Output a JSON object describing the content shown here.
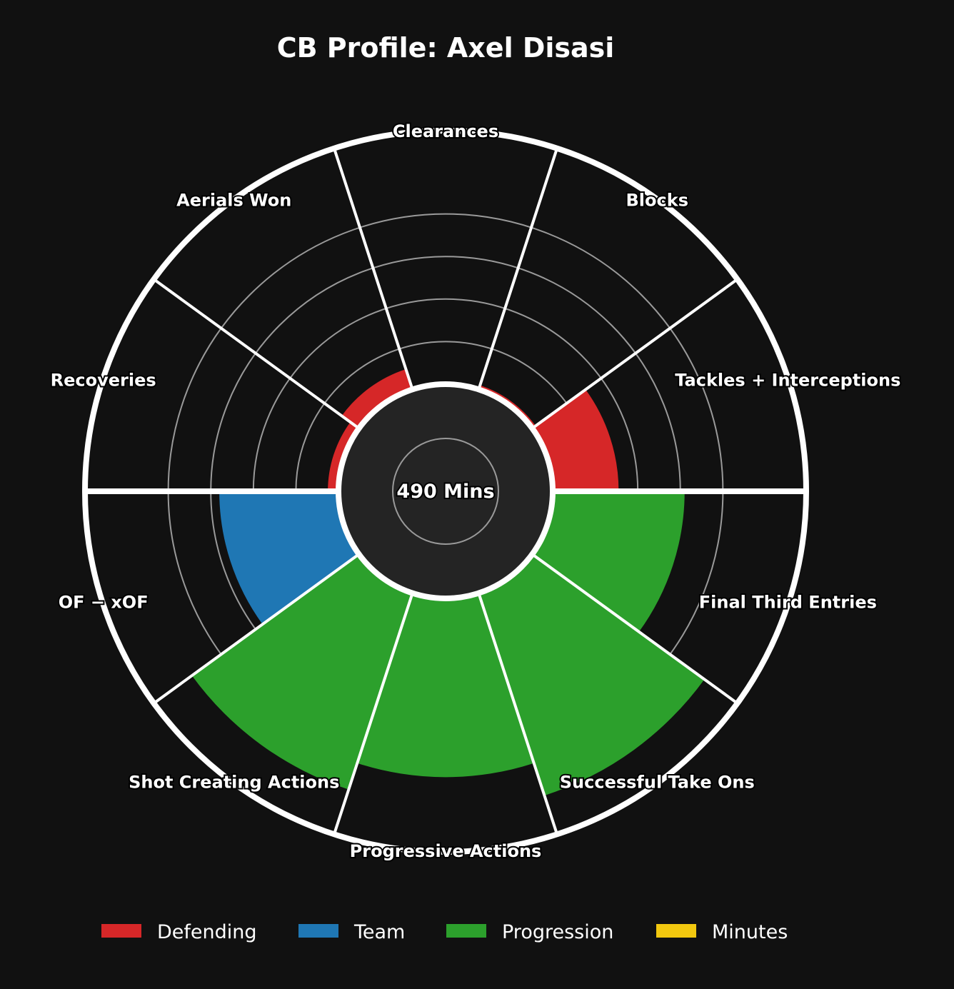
{
  "chart_data": {
    "type": "polar-bar",
    "title": "CB Profile: Axel Disasi",
    "center_label": "490 Mins",
    "scale_max": 100,
    "grid_rings": [
      20,
      40,
      60,
      80
    ],
    "categories": [
      {
        "label": "Tackles + Interceptions",
        "value": 31,
        "group": "Defending"
      },
      {
        "label": "Blocks",
        "value": 2,
        "group": "Defending"
      },
      {
        "label": "Clearances",
        "value": 1,
        "group": "Defending"
      },
      {
        "label": "Aerials Won",
        "value": 10,
        "group": "Defending"
      },
      {
        "label": "Recoveries",
        "value": 5,
        "group": "Defending"
      },
      {
        "label": "OF − xOF",
        "value": 56,
        "group": "Team"
      },
      {
        "label": "Shot Creating Actions",
        "value": 97,
        "group": "Progression"
      },
      {
        "label": "Progressive Actions",
        "value": 84,
        "group": "Progression"
      },
      {
        "label": "Successful Take Ons",
        "value": 100,
        "group": "Progression"
      },
      {
        "label": "Final Third Entries",
        "value": 62,
        "group": "Progression"
      }
    ],
    "legend": {
      "position": "bottom",
      "entries": [
        {
          "name": "Defending",
          "color": "#d62728"
        },
        {
          "name": "Team",
          "color": "#1f77b4"
        },
        {
          "name": "Progression",
          "color": "#2ca02c"
        },
        {
          "name": "Minutes",
          "color": "#f2c80f"
        }
      ]
    },
    "colors": {
      "background": "#111111",
      "center": "#242424",
      "grid": "#9a9a9a",
      "divider": "#ffffff"
    }
  }
}
